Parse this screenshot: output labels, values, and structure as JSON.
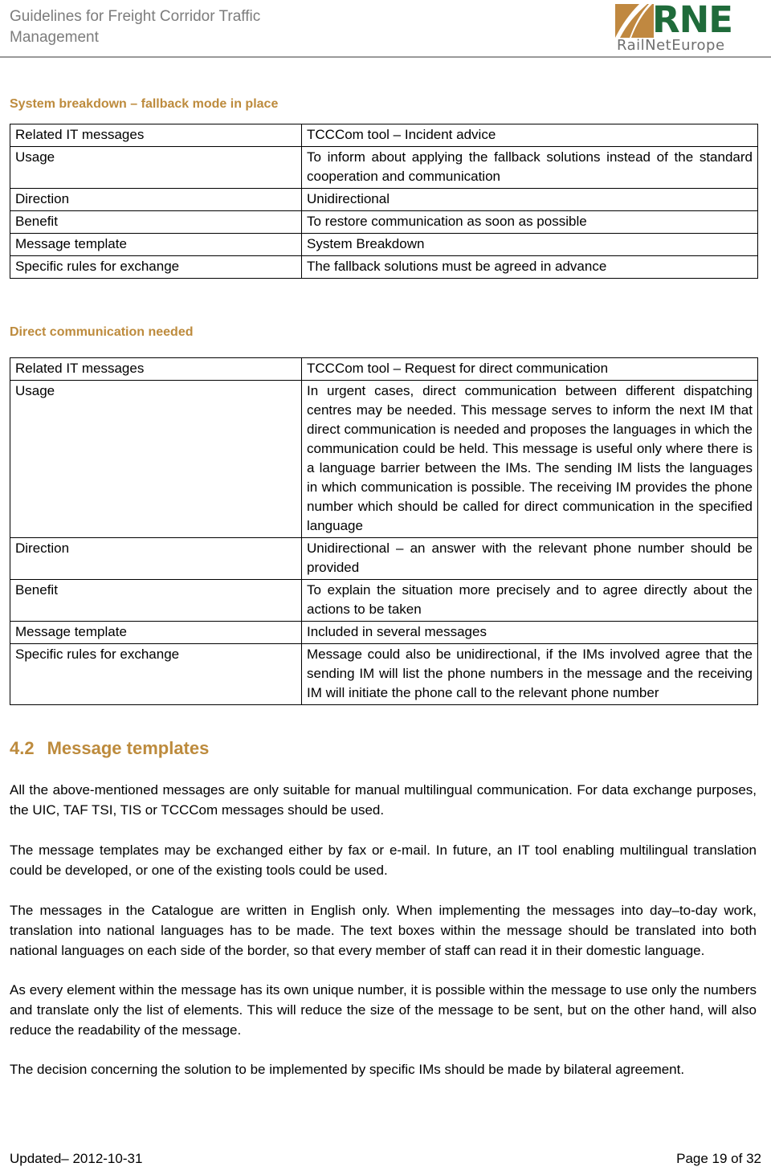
{
  "header": {
    "title": "Guidelines for Freight Corridor Traffic\nManagement",
    "logo": {
      "wordmark": "RNE",
      "subtitle": "RailNetEurope",
      "mark_name": "rne-rail-track-mark",
      "green": "#1f6b3a",
      "orange": "#c08840",
      "gray": "#6f6f6f"
    }
  },
  "accent_color": "#bd8b3d",
  "sections": {
    "system_breakdown": {
      "heading": "System breakdown – fallback mode in place",
      "rows": [
        {
          "label": "Related IT messages",
          "value": "TCCCom tool – Incident advice"
        },
        {
          "label": "Usage",
          "value": "To inform about applying the fallback solutions instead of the standard cooperation and communication"
        },
        {
          "label": "Direction",
          "value": "Unidirectional"
        },
        {
          "label": "Benefit",
          "value": "To restore communication as soon as possible"
        },
        {
          "label": "Message template",
          "value": "System Breakdown"
        },
        {
          "label": "Specific rules for exchange",
          "value": "The fallback solutions must be agreed in advance"
        }
      ]
    },
    "direct_communication": {
      "heading": "Direct communication needed",
      "rows": [
        {
          "label": "Related IT messages",
          "value": "TCCCom tool – Request for direct communication"
        },
        {
          "label": "Usage",
          "value": "In urgent cases, direct communication between different dispatching centres may be needed. This message serves to inform the next IM that direct communication is needed and proposes the languages in which the communication could be held. This message is useful only where there is a language barrier between the IMs. The sending IM lists the languages in which communication is possible. The receiving IM provides the phone number which should be called for direct communication in the specified language"
        },
        {
          "label": "Direction",
          "value": "Unidirectional – an answer with the relevant phone number should be provided"
        },
        {
          "label": "Benefit",
          "value": "To explain the situation more precisely and to agree directly about the actions to be taken"
        },
        {
          "label": "Message template",
          "value": "Included in several messages"
        },
        {
          "label": "Specific rules for exchange",
          "value": "Message could also be unidirectional, if the IMs involved agree that the sending IM will list the phone numbers in the message and the receiving IM will initiate the phone call to the relevant phone number"
        }
      ]
    },
    "message_templates": {
      "number": "4.2",
      "title": "Message templates",
      "paragraphs": [
        "All the above-mentioned messages are only suitable for manual multilingual communication. For data exchange purposes, the UIC, TAF TSI, TIS or TCCCom messages should be used.",
        "The message templates may be exchanged either by fax or e-mail. In future, an IT tool enabling multilingual translation could be developed, or one of the existing tools could be used.",
        "The messages in the Catalogue are written in English only. When implementing the messages into day–to-day work, translation into national languages has to be made.  The text boxes within the message should be translated into both national languages on each side of the border, so that every member of staff can read it in their domestic language.",
        "As every element within the message has its own unique number, it is possible within the message to use only the numbers and translate only the list of elements. This will reduce the size of the message to be sent, but on the other hand, will also reduce the readability of the message.",
        "The decision concerning the solution to be implemented by specific IMs should be made by bilateral agreement."
      ]
    }
  },
  "footer": {
    "updated": "Updated– 2012-10-31",
    "page": "Page 19 of 32"
  }
}
